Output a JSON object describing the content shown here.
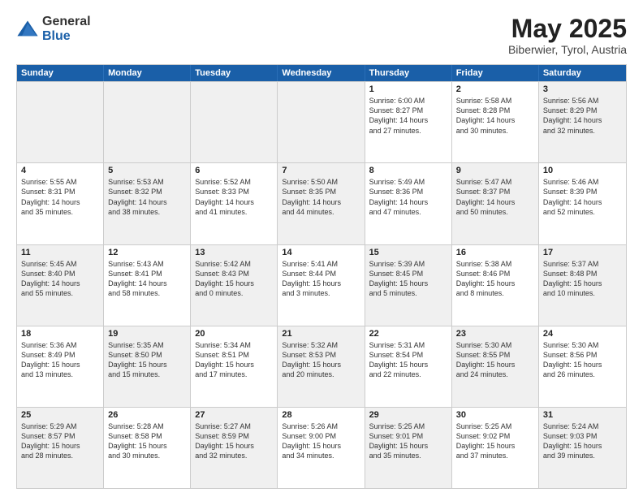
{
  "logo": {
    "general": "General",
    "blue": "Blue"
  },
  "title": "May 2025",
  "location": "Biberwier, Tyrol, Austria",
  "header_days": [
    "Sunday",
    "Monday",
    "Tuesday",
    "Wednesday",
    "Thursday",
    "Friday",
    "Saturday"
  ],
  "weeks": [
    [
      {
        "day": "",
        "info": "",
        "shaded": true
      },
      {
        "day": "",
        "info": "",
        "shaded": true
      },
      {
        "day": "",
        "info": "",
        "shaded": true
      },
      {
        "day": "",
        "info": "",
        "shaded": true
      },
      {
        "day": "1",
        "info": "Sunrise: 6:00 AM\nSunset: 8:27 PM\nDaylight: 14 hours\nand 27 minutes.",
        "shaded": false
      },
      {
        "day": "2",
        "info": "Sunrise: 5:58 AM\nSunset: 8:28 PM\nDaylight: 14 hours\nand 30 minutes.",
        "shaded": false
      },
      {
        "day": "3",
        "info": "Sunrise: 5:56 AM\nSunset: 8:29 PM\nDaylight: 14 hours\nand 32 minutes.",
        "shaded": true
      }
    ],
    [
      {
        "day": "4",
        "info": "Sunrise: 5:55 AM\nSunset: 8:31 PM\nDaylight: 14 hours\nand 35 minutes.",
        "shaded": false
      },
      {
        "day": "5",
        "info": "Sunrise: 5:53 AM\nSunset: 8:32 PM\nDaylight: 14 hours\nand 38 minutes.",
        "shaded": true
      },
      {
        "day": "6",
        "info": "Sunrise: 5:52 AM\nSunset: 8:33 PM\nDaylight: 14 hours\nand 41 minutes.",
        "shaded": false
      },
      {
        "day": "7",
        "info": "Sunrise: 5:50 AM\nSunset: 8:35 PM\nDaylight: 14 hours\nand 44 minutes.",
        "shaded": true
      },
      {
        "day": "8",
        "info": "Sunrise: 5:49 AM\nSunset: 8:36 PM\nDaylight: 14 hours\nand 47 minutes.",
        "shaded": false
      },
      {
        "day": "9",
        "info": "Sunrise: 5:47 AM\nSunset: 8:37 PM\nDaylight: 14 hours\nand 50 minutes.",
        "shaded": true
      },
      {
        "day": "10",
        "info": "Sunrise: 5:46 AM\nSunset: 8:39 PM\nDaylight: 14 hours\nand 52 minutes.",
        "shaded": false
      }
    ],
    [
      {
        "day": "11",
        "info": "Sunrise: 5:45 AM\nSunset: 8:40 PM\nDaylight: 14 hours\nand 55 minutes.",
        "shaded": true
      },
      {
        "day": "12",
        "info": "Sunrise: 5:43 AM\nSunset: 8:41 PM\nDaylight: 14 hours\nand 58 minutes.",
        "shaded": false
      },
      {
        "day": "13",
        "info": "Sunrise: 5:42 AM\nSunset: 8:43 PM\nDaylight: 15 hours\nand 0 minutes.",
        "shaded": true
      },
      {
        "day": "14",
        "info": "Sunrise: 5:41 AM\nSunset: 8:44 PM\nDaylight: 15 hours\nand 3 minutes.",
        "shaded": false
      },
      {
        "day": "15",
        "info": "Sunrise: 5:39 AM\nSunset: 8:45 PM\nDaylight: 15 hours\nand 5 minutes.",
        "shaded": true
      },
      {
        "day": "16",
        "info": "Sunrise: 5:38 AM\nSunset: 8:46 PM\nDaylight: 15 hours\nand 8 minutes.",
        "shaded": false
      },
      {
        "day": "17",
        "info": "Sunrise: 5:37 AM\nSunset: 8:48 PM\nDaylight: 15 hours\nand 10 minutes.",
        "shaded": true
      }
    ],
    [
      {
        "day": "18",
        "info": "Sunrise: 5:36 AM\nSunset: 8:49 PM\nDaylight: 15 hours\nand 13 minutes.",
        "shaded": false
      },
      {
        "day": "19",
        "info": "Sunrise: 5:35 AM\nSunset: 8:50 PM\nDaylight: 15 hours\nand 15 minutes.",
        "shaded": true
      },
      {
        "day": "20",
        "info": "Sunrise: 5:34 AM\nSunset: 8:51 PM\nDaylight: 15 hours\nand 17 minutes.",
        "shaded": false
      },
      {
        "day": "21",
        "info": "Sunrise: 5:32 AM\nSunset: 8:53 PM\nDaylight: 15 hours\nand 20 minutes.",
        "shaded": true
      },
      {
        "day": "22",
        "info": "Sunrise: 5:31 AM\nSunset: 8:54 PM\nDaylight: 15 hours\nand 22 minutes.",
        "shaded": false
      },
      {
        "day": "23",
        "info": "Sunrise: 5:30 AM\nSunset: 8:55 PM\nDaylight: 15 hours\nand 24 minutes.",
        "shaded": true
      },
      {
        "day": "24",
        "info": "Sunrise: 5:30 AM\nSunset: 8:56 PM\nDaylight: 15 hours\nand 26 minutes.",
        "shaded": false
      }
    ],
    [
      {
        "day": "25",
        "info": "Sunrise: 5:29 AM\nSunset: 8:57 PM\nDaylight: 15 hours\nand 28 minutes.",
        "shaded": true
      },
      {
        "day": "26",
        "info": "Sunrise: 5:28 AM\nSunset: 8:58 PM\nDaylight: 15 hours\nand 30 minutes.",
        "shaded": false
      },
      {
        "day": "27",
        "info": "Sunrise: 5:27 AM\nSunset: 8:59 PM\nDaylight: 15 hours\nand 32 minutes.",
        "shaded": true
      },
      {
        "day": "28",
        "info": "Sunrise: 5:26 AM\nSunset: 9:00 PM\nDaylight: 15 hours\nand 34 minutes.",
        "shaded": false
      },
      {
        "day": "29",
        "info": "Sunrise: 5:25 AM\nSunset: 9:01 PM\nDaylight: 15 hours\nand 35 minutes.",
        "shaded": true
      },
      {
        "day": "30",
        "info": "Sunrise: 5:25 AM\nSunset: 9:02 PM\nDaylight: 15 hours\nand 37 minutes.",
        "shaded": false
      },
      {
        "day": "31",
        "info": "Sunrise: 5:24 AM\nSunset: 9:03 PM\nDaylight: 15 hours\nand 39 minutes.",
        "shaded": true
      }
    ]
  ]
}
